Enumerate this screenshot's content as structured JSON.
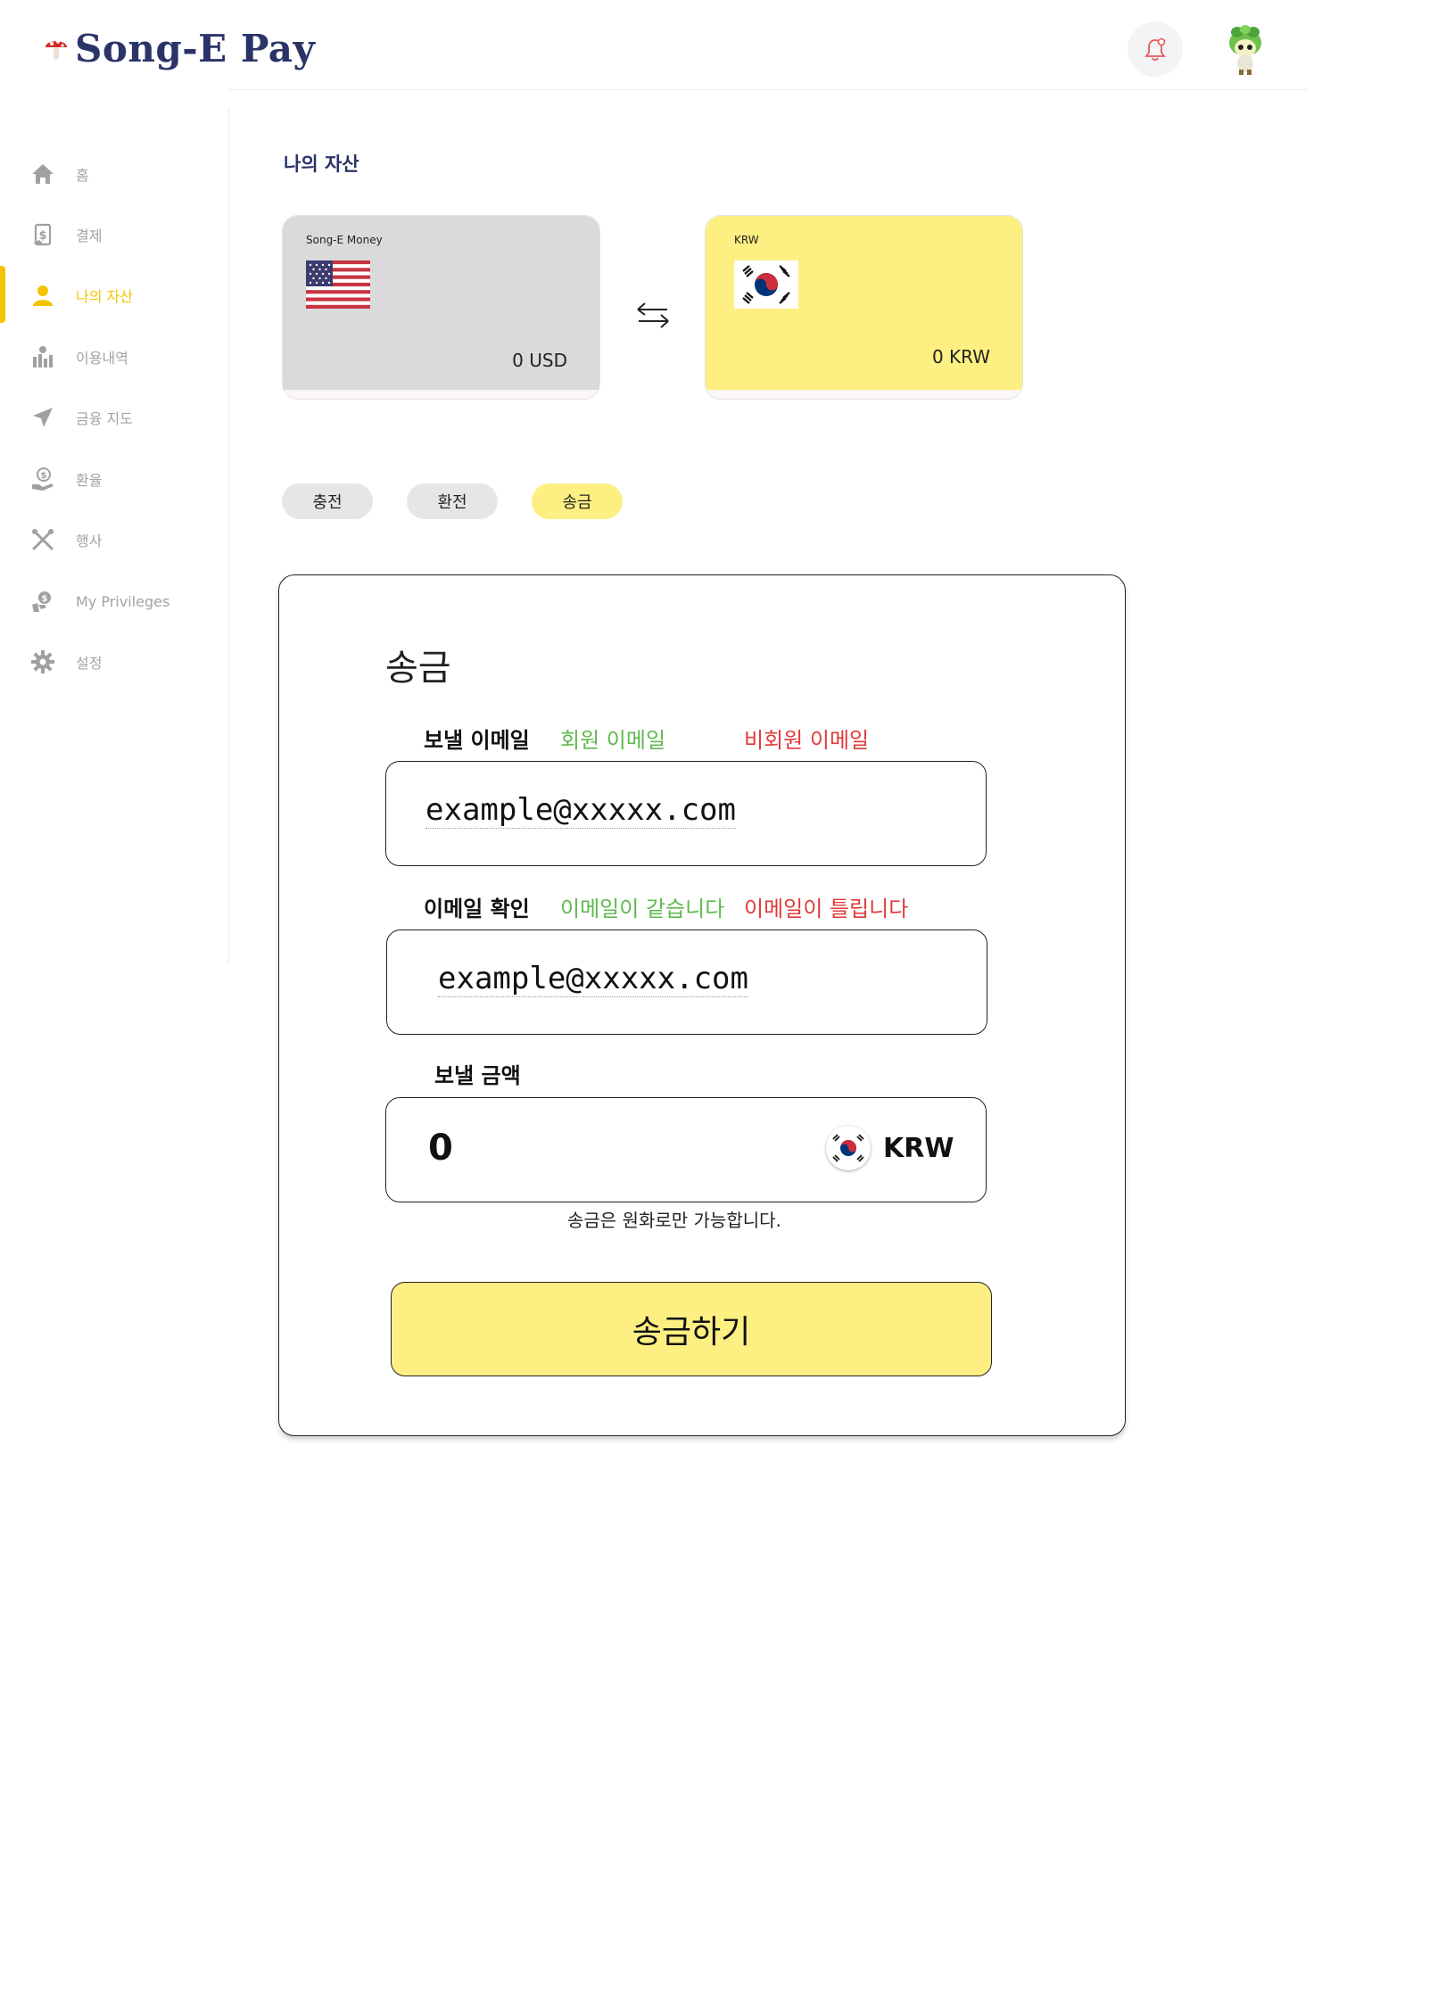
{
  "header": {
    "app_name": "Song-E Pay"
  },
  "sidebar": {
    "items": [
      {
        "label": "홈",
        "icon": "home-icon"
      },
      {
        "label": "결제",
        "icon": "payment-icon"
      },
      {
        "label": "나의 자산",
        "icon": "user-icon",
        "active": true
      },
      {
        "label": "이용내역",
        "icon": "history-icon"
      },
      {
        "label": "금융 지도",
        "icon": "navigation-icon"
      },
      {
        "label": "환율",
        "icon": "exchange-rate-icon"
      },
      {
        "label": "행사",
        "icon": "event-icon"
      },
      {
        "label": "My Privileges",
        "icon": "privileges-icon"
      },
      {
        "label": "설정",
        "icon": "gear-icon"
      }
    ]
  },
  "assets": {
    "title": "나의 자산",
    "usd_card": {
      "label": "Song-E Money",
      "balance": "0 USD"
    },
    "krw_card": {
      "label": "KRW",
      "balance": "0 KRW"
    }
  },
  "tabs": [
    {
      "label": "충전"
    },
    {
      "label": "환전"
    },
    {
      "label": "송금",
      "active": true
    }
  ],
  "form": {
    "title": "송금",
    "recipient_label": "보낼 이메일",
    "member_email": "회원 이메일",
    "non_member_email": "비회원 이메일",
    "recipient_value": "example@xxxxx.com",
    "confirm_label": "이메일 확인",
    "email_match": "이메일이 같습니다",
    "email_mismatch": "이메일이 틀립니다",
    "confirm_value": "example@xxxxx.com",
    "amount_label": "보낼 금액",
    "amount_value": "0",
    "currency": "KRW",
    "note": "송금은 원화로만 가능합니다.",
    "submit": "송금하기"
  },
  "colors": {
    "brand_navy": "#2b3468",
    "accent_yellow": "#f3c400",
    "card_yellow": "#fdef81",
    "success_green": "#5fb94e",
    "error_red": "#e03b3b"
  }
}
